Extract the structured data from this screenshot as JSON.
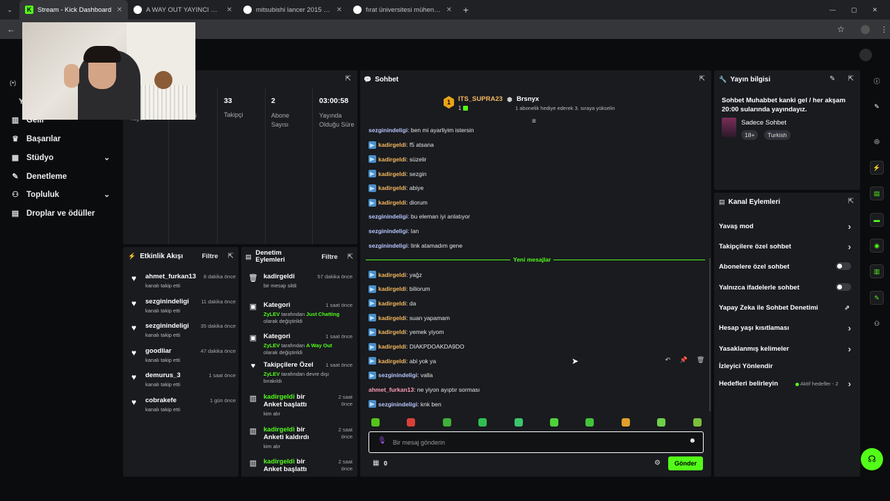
{
  "browser": {
    "tabs": [
      {
        "title": "Stream - Kick Dashboard",
        "active": true
      },
      {
        "title": "A WAY OUT YAYINCI MODU - G"
      },
      {
        "title": "mitsubishi lancer 2015 - Googl"
      },
      {
        "title": "fırat üniversitesi mühendisliği D"
      }
    ],
    "new_tab": "+"
  },
  "sidebar": {
    "items": [
      {
        "label": "Gelir",
        "icon": "chart-icon"
      },
      {
        "label": "Başarılar",
        "icon": "trophy-icon"
      },
      {
        "label": "Stüdyo",
        "icon": "studio-icon",
        "expandable": true
      },
      {
        "label": "Denetleme",
        "icon": "wrench-icon"
      },
      {
        "label": "Topluluk",
        "icon": "community-icon",
        "expandable": true
      },
      {
        "label": "Droplar ve ödüller",
        "icon": "drops-icon"
      }
    ]
  },
  "stats": {
    "partial_label": "Yayın",
    "partial_label2": "i",
    "items": [
      {
        "value": "33",
        "label": "Takipçi"
      },
      {
        "value": "2",
        "label": "Abone Sayısı"
      },
      {
        "value": "03:00:58",
        "label": "Yayında Olduğu Süre"
      }
    ]
  },
  "activity": {
    "title": "Etkinlik Akışı",
    "filter": "Filtre",
    "items": [
      {
        "name": "ahmet_furkan13",
        "time": "8 dakika önce",
        "sub": "kanalı takip etti"
      },
      {
        "name": "sezginindeligi",
        "time": "11 dakika önce",
        "sub": "kanalı takip etti"
      },
      {
        "name": "sezginindeligi",
        "time": "35 dakika önce",
        "sub": "kanalı takip etti"
      },
      {
        "name": "goodliar",
        "time": "47 dakika önce",
        "sub": "kanalı takip etti"
      },
      {
        "name": "demurus_3",
        "time": "1 saat önce",
        "sub": "kanalı takip etti"
      },
      {
        "name": "cobrakefe",
        "time": "1 gün önce",
        "sub": "kanalı takip etti"
      }
    ]
  },
  "moderation": {
    "title": "Denetim Eylemleri",
    "filter": "Filtre",
    "items": [
      {
        "title": "kadirgeldi",
        "time": "57 dakika önce",
        "sub": "bir mesajı sildi"
      },
      {
        "title": "Kategori",
        "time": "1 saat önce",
        "actor": "ZyLEV",
        "mid": " tarafından ",
        "hl": "Just Chatting",
        "tail": "olarak değiştirildi"
      },
      {
        "title": "Kategori",
        "time": "1 saat önce",
        "actor": "ZyLEV",
        "mid": " tarafından ",
        "hl": "A Way Out",
        "tail": "olarak değiştirildi"
      },
      {
        "title": "Takipçilere Özel",
        "time": "1 saat önce",
        "actor": "ZyLEV",
        "mid": " tarafından devre dışı",
        "hl": "",
        "tail": "bırakıldı"
      },
      {
        "actor": "kadirgeldi",
        "rest": " bir Anket başlattı",
        "time": "2 saat önce",
        "sub": "kim alır"
      },
      {
        "actor": "kadirgeldi",
        "rest": " bir Anketi kaldırdı",
        "time": "2 saat önce",
        "sub": "kim alır"
      },
      {
        "actor": "kadirgeldi",
        "rest": " bir Anket başlattı",
        "time": "2 saat önce"
      }
    ]
  },
  "chat": {
    "title": "Sohbet",
    "top_gifter": {
      "rank": "1",
      "name": "ITS_SUPRA23",
      "count": "1"
    },
    "second": {
      "name": "Brsnyx",
      "note": "1 abonelik hediye ederek 3. sıraya yükselin"
    },
    "new_messages": "Yeni mesajlar",
    "messages": [
      {
        "user": "sezginindeligi",
        "text": ": ben mi ayarliyim istersin",
        "color": "blue",
        "badge": false
      },
      {
        "user": "kadirgeldi",
        "text": ": f5 atsana",
        "color": "orange",
        "badge": true
      },
      {
        "user": "kadirgeldi",
        "text": ": süzelir",
        "color": "orange",
        "badge": true
      },
      {
        "user": "kadirgeldi",
        "text": ": sezgin",
        "color": "orange",
        "badge": true
      },
      {
        "user": "kadirgeldi",
        "text": ": abiye",
        "color": "orange",
        "badge": true
      },
      {
        "user": "kadirgeldi",
        "text": ": diorum",
        "color": "orange",
        "badge": true
      },
      {
        "user": "sezginindeligi",
        "text": ": bu eleman iyi anlatıyor",
        "color": "blue",
        "badge": false
      },
      {
        "user": "sezginindeligi",
        "text": ": lan",
        "color": "blue",
        "badge": false
      },
      {
        "user": "sezginindeligi",
        "text": ": link atamadım gene",
        "color": "blue",
        "badge": false
      }
    ],
    "messages2": [
      {
        "user": "kadirgeldi",
        "text": ": yağz",
        "color": "orange",
        "badge": true
      },
      {
        "user": "kadirgeldi",
        "text": ": biliorum",
        "color": "orange",
        "badge": true
      },
      {
        "user": "kadirgeldi",
        "text": ": da",
        "color": "orange",
        "badge": true
      },
      {
        "user": "kadirgeldi",
        "text": ": suan yapamam",
        "color": "orange",
        "badge": true
      },
      {
        "user": "kadirgeldi",
        "text": ": yemek yiyom",
        "color": "orange",
        "badge": true
      },
      {
        "user": "kadirgeldi",
        "text": ": DIAKPDOAKDA9DO",
        "color": "orange",
        "badge": true
      },
      {
        "user": "kadirgeldi",
        "text": ": abi yok ya",
        "color": "orange",
        "badge": true
      },
      {
        "user": "sezginindeligi",
        "text": ": valla",
        "color": "blue",
        "badge": true
      },
      {
        "user": "ahmet_furkan13",
        "text": ": ne yiyon ayıptır sorması",
        "color": "pink",
        "badge": false
      },
      {
        "user": "sezginindeligi",
        "text": ": knk ben",
        "color": "blue",
        "badge": true
      }
    ],
    "input_placeholder": "Bir mesaj gönderin",
    "points": "0",
    "send": "Gönder",
    "emote_colors": [
      "#53c41a",
      "#d9403a",
      "#3fae3a",
      "#2fbf4f",
      "#3cc46d",
      "#4fd13a",
      "#44c23c",
      "#e0a02b",
      "#6fcf4a",
      "#7bbf3a"
    ]
  },
  "stream_info": {
    "title": "Yayın bilgisi",
    "description": "Sohbet Muhabbet kanki gel / her akşam 20:00 sularında yayındayız.",
    "category": "Sadece Sohbet",
    "tags": [
      "18+",
      "Turkish"
    ]
  },
  "channel_actions": {
    "title": "Kanal Eylemleri",
    "items": [
      {
        "label": "Yavaş mod",
        "type": "chevron"
      },
      {
        "label": "Takipçilere özel sohbet",
        "type": "chevron"
      },
      {
        "label": "Abonelere özel sohbet",
        "type": "toggle"
      },
      {
        "label": "Yalnızca ifadelerle sohbet",
        "type": "toggle"
      },
      {
        "label": "Yapay Zeka ile Sohbet Denetimi",
        "type": "external"
      },
      {
        "label": "Hesap yaşı kısıtlaması",
        "type": "chevron"
      },
      {
        "label": "Yasaklanmış kelimeler",
        "type": "chevron"
      },
      {
        "label": "İzleyici Yönlendir",
        "type": "none"
      },
      {
        "label": "Hedefleri belirleyin",
        "type": "chevron",
        "extra": "Aktif hedefler - 2"
      }
    ]
  },
  "colors": {
    "accent": "#53fc18",
    "panel": "#191b1f",
    "bg": "#0b0c0e"
  }
}
